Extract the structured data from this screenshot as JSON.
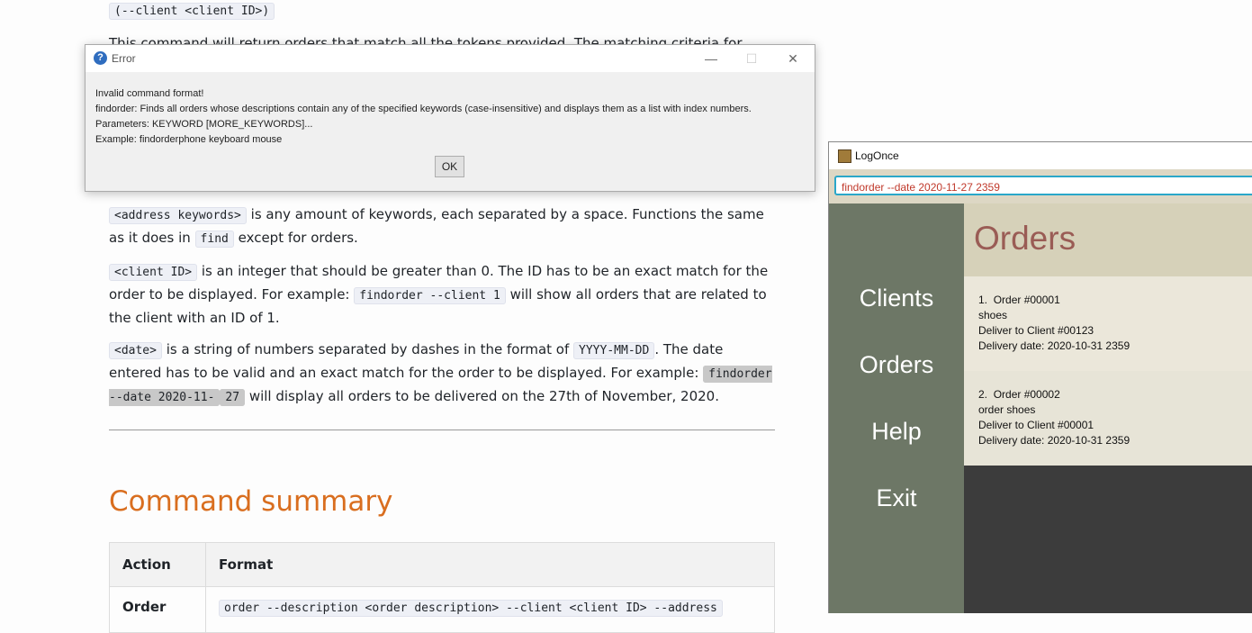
{
  "doc": {
    "top_code": "(--client <client ID>)",
    "intro_text": "This command will return orders that match all the tokens provided. The matching criteria for each token",
    "address_code": "<address keywords>",
    "address_text1": " is any amount of keywords, each separated by a space. Functions the same as it does in ",
    "address_find": "find",
    "address_text2": " except for orders.",
    "client_code": "<client ID>",
    "client_text1": " is an integer that should be greater than 0. The ID has to be an exact match for the order to be displayed. For example: ",
    "client_example": "findorder --client 1",
    "client_text2": " will show all orders that are related to the client with an ID of 1.",
    "date_code": "<date>",
    "date_text1": " is a string of numbers separated by dashes in the format of ",
    "date_format": "YYYY-MM-DD",
    "date_text2": ". The date entered has to be valid and an exact match for the order to be displayed. For example: ",
    "date_example_a": "findorder --date 2020-11-",
    "date_example_b": "27",
    "date_text3": " will display all orders to be delivered on the 27th of November, 2020.",
    "summary_heading": "Command summary",
    "table_headers": [
      "Action",
      "Format"
    ],
    "table_row_action": "Order",
    "table_row_format": "order --description <order description> --client <client ID> --address"
  },
  "dialog": {
    "title": "Error",
    "icon": "question-icon",
    "minimize": "—",
    "maximize": "☐",
    "close": "✕",
    "lines": [
      "Invalid command format!",
      "findorder: Finds all orders whose descriptions contain any of the specified keywords (case-insensitive) and displays them as a list with index numbers.",
      "Parameters: KEYWORD [MORE_KEYWORDS]...",
      "Example: findorderphone keyboard mouse"
    ],
    "ok_label": "OK"
  },
  "app": {
    "title": "LogOnce",
    "command_value": "findorder --date 2020-11-27 2359",
    "nav": [
      "Clients",
      "Orders",
      "Help",
      "Exit"
    ],
    "header": "Orders",
    "orders": [
      {
        "index": "1.",
        "id": "Order #00001",
        "description": "shoes",
        "client": "Deliver to Client #00123",
        "date": "Delivery date: 2020-10-31 2359",
        "bg": "#ebe7da"
      },
      {
        "index": "2.",
        "id": "Order #00002",
        "description": "order shoes",
        "client": "Deliver to Client #00001",
        "date": "Delivery date: 2020-10-31 2359",
        "bg": "#e7e4d7"
      }
    ],
    "colors": {
      "sidebar": "#6d7766",
      "header_bg": "#d6d1b9",
      "header_text": "#9a5c55",
      "command_text": "#c0392b"
    }
  }
}
